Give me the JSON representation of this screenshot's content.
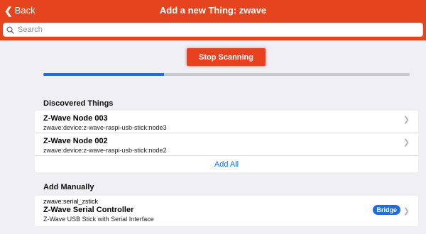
{
  "navbar": {
    "back_label": "Back",
    "title": "Add a new Thing: zwave"
  },
  "search": {
    "placeholder": "Search"
  },
  "scan": {
    "button_label": "Stop Scanning",
    "progress": 0.33
  },
  "discovered": {
    "header": "Discovered Things",
    "items": [
      {
        "title": "Z-Wave Node 003",
        "subtitle": "zwave:device:z-wave-raspi-usb-stick:node3"
      },
      {
        "title": "Z-Wave Node 002",
        "subtitle": "zwave:device:z-wave-raspi-usb-stick:node2"
      }
    ],
    "add_all_label": "Add All"
  },
  "manual": {
    "header": "Add Manually",
    "items": [
      {
        "pre": "zwave:serial_zstick",
        "title": "Z-Wave Serial Controller",
        "subtitle": "Z-Wave USB Stick with Serial Interface",
        "badge": "Bridge"
      }
    ]
  },
  "colors": {
    "accent": "#e6441e",
    "link": "#1f6fd9",
    "background": "#efeff4"
  }
}
